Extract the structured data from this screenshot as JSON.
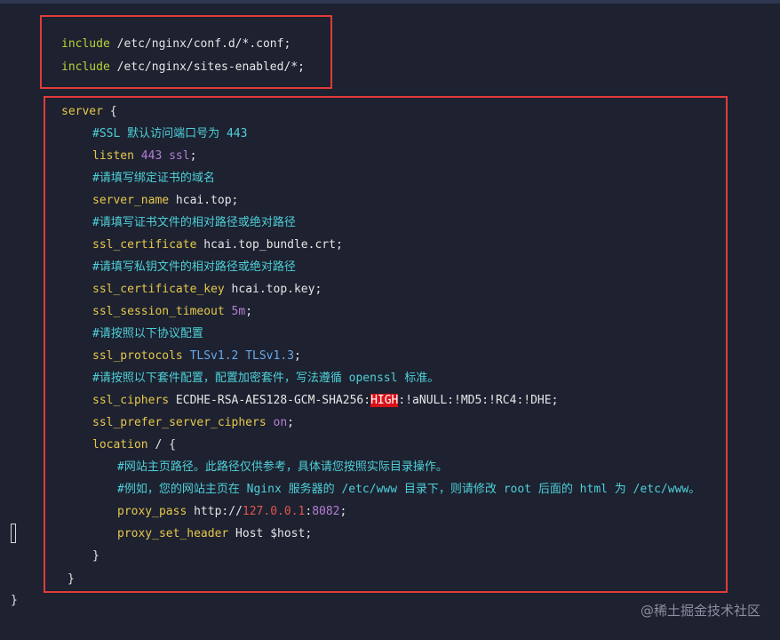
{
  "code": {
    "l1": {
      "kw": "include",
      "text": " /etc/nginx/conf.d/*.conf;"
    },
    "l2": {
      "kw": "include",
      "text": " /etc/nginx/sites-enabled/*;"
    },
    "server_kw": "server",
    "server_brace": " {",
    "c_ssl": "#SSL 默认访问端口号为 443",
    "listen": {
      "kw": "listen",
      "num": " 443",
      "v": " ssl",
      "end": ";"
    },
    "c_domain": "#请填写绑定证书的域名",
    "server_name": {
      "kw": "server_name",
      "v": " hcai.top;"
    },
    "c_cert": "#请填写证书文件的相对路径或绝对路径",
    "ssl_certificate": {
      "kw": "ssl_certificate",
      "v": " hcai.top_bundle.crt;"
    },
    "c_key": "#请填写私钥文件的相对路径或绝对路径",
    "ssl_certificate_key": {
      "kw": "ssl_certificate_key",
      "v": " hcai.top.key;"
    },
    "ssl_session_timeout": {
      "kw": "ssl_session_timeout",
      "num": " 5m",
      "end": ";"
    },
    "c_protocol": "#请按照以下协议配置",
    "ssl_protocols": {
      "kw": "ssl_protocols",
      "v": " TLSv1.2 TLSv1.3",
      "end": ";"
    },
    "c_ciphers": "#请按照以下套件配置，配置加密套件，写法遵循 openssl 标准。",
    "ssl_ciphers": {
      "kw": "ssl_ciphers",
      "pre": " ECDHE-RSA-AES128-GCM-SHA256:",
      "hl": "HIGH",
      "post": ":!aNULL:!MD5:!RC4:!DHE;"
    },
    "ssl_prefer": {
      "kw": "ssl_prefer_server_ciphers",
      "num": " on",
      "end": ";"
    },
    "location": {
      "kw": "location",
      "v": " / {"
    },
    "c_home": "#网站主页路径。此路径仅供参考，具体请您按照实际目录操作。",
    "c_example": "#例如，您的网站主页在 Nginx 服务器的 /etc/www 目录下，则请修改 root 后面的 html 为 /etc/www。",
    "proxy_pass": {
      "kw": "proxy_pass",
      "pre": " http://",
      "ip": "127.0.0.1",
      "colon": ":",
      "port": "8082",
      "end": ";"
    },
    "proxy_set_header": {
      "kw": "proxy_set_header",
      "v": " Host $host;"
    },
    "close1": "}",
    "close2": "}",
    "close3": "}"
  },
  "watermark": "@稀土掘金技术社区",
  "colors": {
    "background": "#1d2130",
    "highlight_box": "#e23b3b",
    "keyword": "#b7d336",
    "directive": "#e6c84b",
    "comment": "#4fd0d8",
    "number": "#b67fd6"
  }
}
